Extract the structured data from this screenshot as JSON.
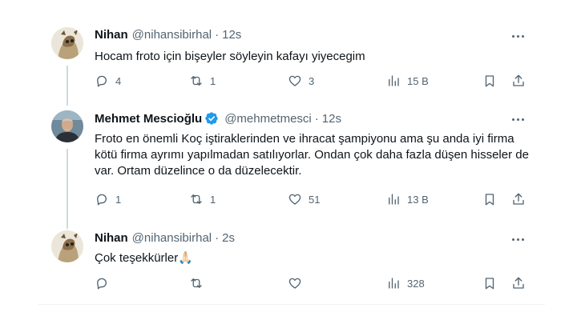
{
  "tweets": [
    {
      "name": "Nihan",
      "handle": "@nihansibirhal",
      "separator": "·",
      "time": "12s",
      "verified": false,
      "text": "Hocam froto için bişeyler söyleyin kafayı yiyecegim",
      "replies": "4",
      "retweets": "1",
      "likes": "3",
      "views": "15 B"
    },
    {
      "name": "Mehmet Mescioğlu",
      "handle": "@mehmetmesci",
      "separator": "·",
      "time": "12s",
      "verified": true,
      "text": "Froto en önemli Koç iştiraklerinden ve ihracat şampiyonu ama şu anda iyi firma kötü firma ayrımı yapılmadan satılıyorlar. Ondan çok daha fazla düşen hisseler de var. Ortam düzelince o da düzelecektir.",
      "replies": "1",
      "retweets": "1",
      "likes": "51",
      "views": "13 B"
    },
    {
      "name": "Nihan",
      "handle": "@nihansibirhal",
      "separator": "·",
      "time": "2s",
      "verified": false,
      "text": "Çok teşekkürler🙏🏻",
      "replies": "",
      "retweets": "",
      "likes": "",
      "views": "328"
    }
  ],
  "icons": {
    "reply": "reply-icon",
    "retweet": "retweet-icon",
    "like": "like-icon",
    "views": "views-icon",
    "bookmark": "bookmark-icon",
    "share": "share-icon",
    "more": "more-icon",
    "verified": "verified-badge-icon"
  },
  "colors": {
    "text": "#0f1419",
    "secondary": "#536471",
    "verified": "#1d9bf0",
    "thread_line": "#cfd9de",
    "divider": "#eff3f4"
  }
}
